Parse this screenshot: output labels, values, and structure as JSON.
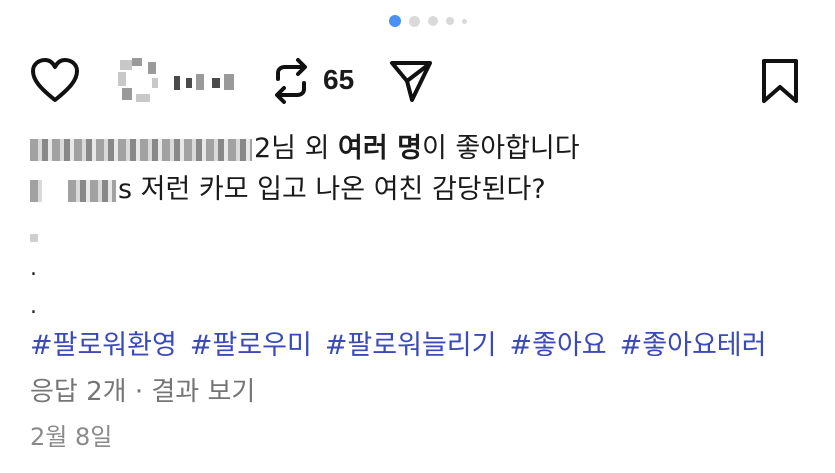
{
  "carousel": {
    "total": 5,
    "active_index": 0,
    "accent_color": "#4a90f5"
  },
  "actions": {
    "like_icon": "heart-icon",
    "comment_icon": "comment-icon",
    "repost_icon": "repost-icon",
    "repost_count": "65",
    "send_icon": "send-icon",
    "bookmark_icon": "bookmark-icon"
  },
  "likes": {
    "suffix": "2님 외 ",
    "emphasis": "여러 명",
    "tail": "이 좋아합니다"
  },
  "caption": {
    "text": "s 저런 카모 입고 나온 여친 감당된다?"
  },
  "extra_lines": [
    ".",
    "."
  ],
  "hashtags": [
    "#팔로워환영",
    "#팔로우미",
    "#팔로워늘리기",
    "#좋아요",
    "#좋아요테러"
  ],
  "replies_text": "응답 2개 · 결과 보기",
  "date": "2월 8일",
  "colors": {
    "hashtag": "#3a4ab8",
    "muted": "#757575"
  }
}
